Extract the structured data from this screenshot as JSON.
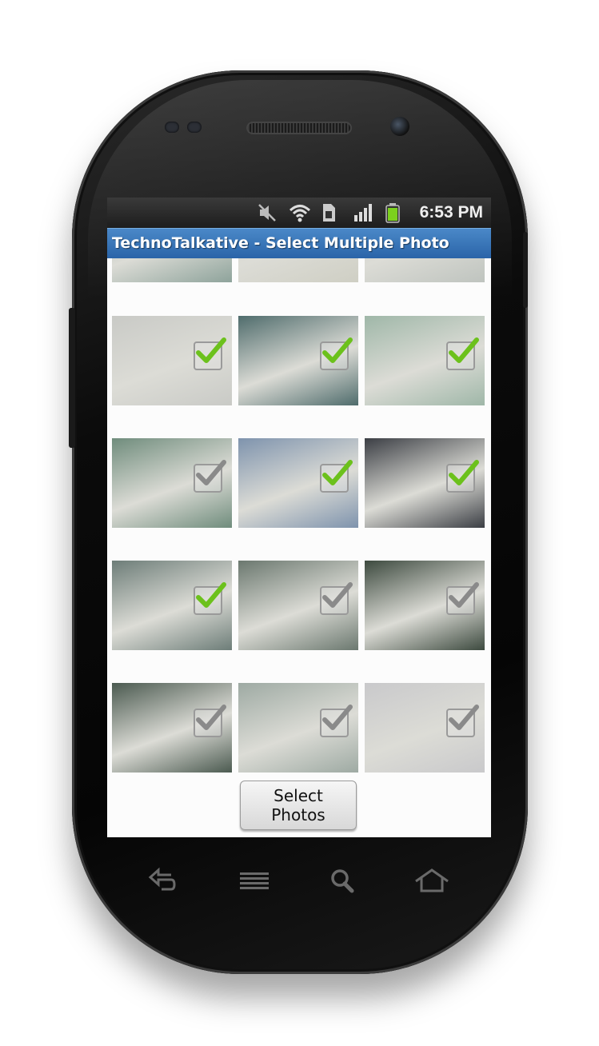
{
  "status_bar": {
    "time": "6:53 PM",
    "icons": [
      "mute-icon",
      "wifi-icon",
      "sim-card-icon",
      "signal-icon",
      "battery-icon"
    ]
  },
  "app_bar": {
    "title": "TechnoTalkative - Select Multiple Photo"
  },
  "grid": {
    "columns": 3,
    "photos": [
      {
        "tone": "#8ea39b",
        "checked": null
      },
      {
        "tone": "#cfcfc4",
        "checked": null
      },
      {
        "tone": "#bfc4bf",
        "checked": null
      },
      {
        "tone": "#c9cac6",
        "checked": true
      },
      {
        "tone": "#4f6c6c",
        "checked": true
      },
      {
        "tone": "#9fb7a8",
        "checked": true
      },
      {
        "tone": "#6f8c7c",
        "checked": false
      },
      {
        "tone": "#7e93ad",
        "checked": true
      },
      {
        "tone": "#3b3e44",
        "checked": true
      },
      {
        "tone": "#6d7d78",
        "checked": true
      },
      {
        "tone": "#6b786f",
        "checked": false
      },
      {
        "tone": "#3d4a3f",
        "checked": false
      },
      {
        "tone": "#4b5a50",
        "checked": false
      },
      {
        "tone": "#9eaaa3",
        "checked": false
      },
      {
        "tone": "#c9c9cb",
        "checked": false
      }
    ]
  },
  "actions": {
    "select_label": "Select Photos"
  },
  "nav_keys": [
    "back-icon",
    "menu-icon",
    "search-icon",
    "home-icon"
  ],
  "colors": {
    "title_bar": "#3b78ba",
    "check_green": "#6cc11c",
    "status_bar": "#262626"
  }
}
